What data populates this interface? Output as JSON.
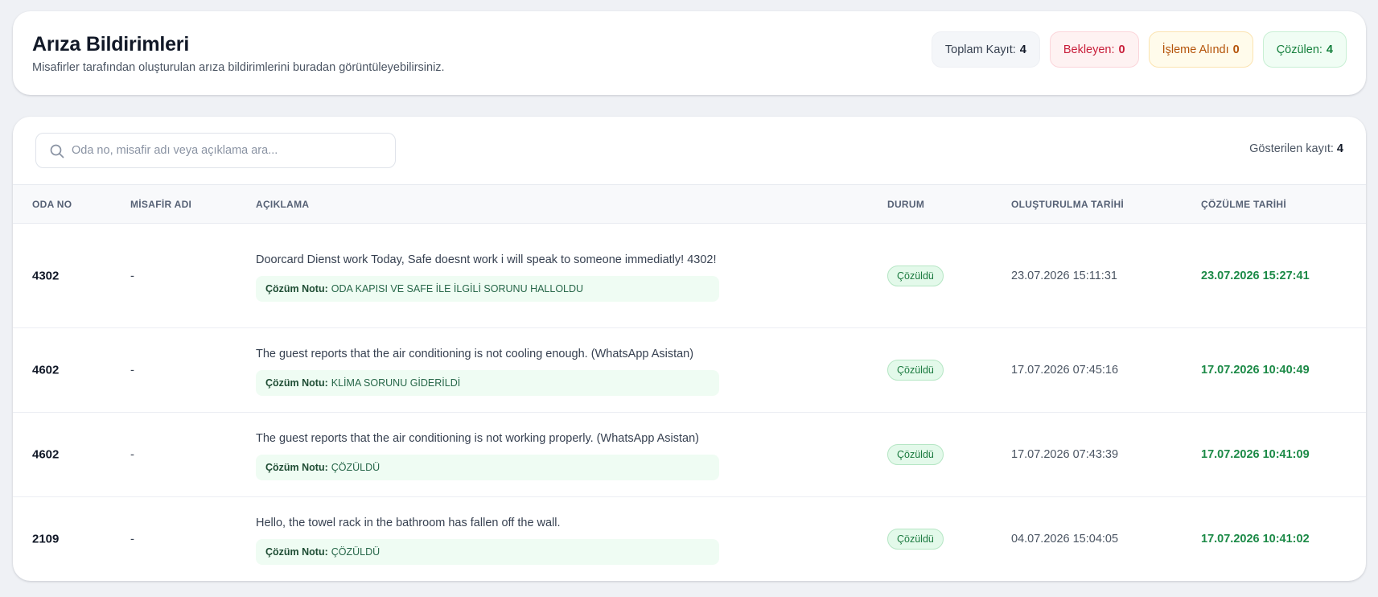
{
  "header": {
    "title": "Arıza Bildirimleri",
    "subtitle": "Misafirler tarafından oluşturulan arıza bildirimlerini buradan görüntüleyebilirsiniz.",
    "stats": {
      "total_label": "Toplam Kayıt:",
      "total_value": "4",
      "pending_label": "Bekleyen:",
      "pending_value": "0",
      "progress_label": "İşleme Alındı",
      "progress_value": "0",
      "solved_label": "Çözülen:",
      "solved_value": "4"
    },
    "colors": {
      "pending": "#c81e3a",
      "progress": "#b45309",
      "solved": "#15803d"
    }
  },
  "search": {
    "placeholder": "Oda no, misafir adı veya açıklama ara...",
    "value": "",
    "icon": "search-icon"
  },
  "shown": {
    "label": "Gösterilen kayıt:",
    "value": "4"
  },
  "table": {
    "columns": {
      "room": "ODA NO",
      "guest": "MİSAFİR ADI",
      "description": "AÇIKLAMA",
      "status": "DURUM",
      "created": "OLUŞTURULMA TARİHİ",
      "resolved": "ÇÖZÜLME TARİHİ"
    },
    "note_label": "Çözüm Notu:",
    "rows": [
      {
        "room": "4302",
        "guest": "-",
        "description": "Doorcard Dienst work Today, Safe doesnt work i will speak to someone immediatly! 4302!",
        "note": "ODA KAPISI VE SAFE İLE İLGİLİ SORUNU HALLOLDU",
        "status": "Çözüldü",
        "created": "23.07.2026 15:11:31",
        "resolved": "23.07.2026 15:27:41"
      },
      {
        "room": "4602",
        "guest": "-",
        "description": "The guest reports that the air conditioning is not cooling enough. (WhatsApp Asistan)",
        "note": "KLİMA SORUNU GİDERİLDİ",
        "status": "Çözüldü",
        "created": "17.07.2026 07:45:16",
        "resolved": "17.07.2026 10:40:49"
      },
      {
        "room": "4602",
        "guest": "-",
        "description": "The guest reports that the air conditioning is not working properly. (WhatsApp Asistan)",
        "note": "ÇÖZÜLDÜ",
        "status": "Çözüldü",
        "created": "17.07.2026 07:43:39",
        "resolved": "17.07.2026 10:41:09"
      },
      {
        "room": "2109",
        "guest": "-",
        "description": "Hello, the towel rack in the bathroom has fallen off the wall.",
        "note": "ÇÖZÜLDÜ",
        "status": "Çözüldü",
        "created": "04.07.2026 15:04:05",
        "resolved": "17.07.2026 10:41:02"
      }
    ]
  }
}
